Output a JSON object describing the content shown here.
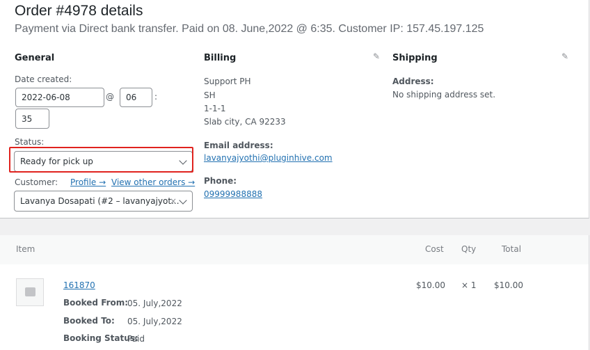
{
  "header": {
    "title": "Order #4978 details",
    "subtitle": "Payment via Direct bank transfer. Paid on 08. June,2022 @ 6:35. Customer IP: 157.45.197.125"
  },
  "general": {
    "title": "General",
    "date_created_label": "Date created:",
    "date_value": "2022-06-08",
    "at_sep": "@",
    "hour_value": "06",
    "colon_sep": ":",
    "minute_value": "35",
    "status_label": "Status:",
    "status_value": "Ready for pick up",
    "customer_label": "Customer:",
    "profile_link": "Profile →",
    "view_orders_link": "View other orders →",
    "customer_value": "Lavanya Dosapati (#2 – lavanyajyot...",
    "clear_glyph": "×"
  },
  "billing": {
    "title": "Billing",
    "address_lines": [
      "Support PH",
      "SH",
      "1-1-1",
      "Slab city, CA 92233"
    ],
    "email_label": "Email address:",
    "email_value": "lavanyajyothi@pluginhive.com",
    "phone_label": "Phone:",
    "phone_value": "09999988888"
  },
  "shipping": {
    "title": "Shipping",
    "address_label": "Address:",
    "address_value": "No shipping address set."
  },
  "icons": {
    "edit": "pencil-icon",
    "chevron": "chevron-down-icon",
    "thumb": "image-placeholder-icon"
  },
  "items": {
    "columns": {
      "item": "Item",
      "cost": "Cost",
      "qty": "Qty",
      "total": "Total"
    },
    "rows": [
      {
        "name": "161870",
        "cost": "$10.00",
        "qty": "× 1",
        "total": "$10.00",
        "meta": [
          {
            "key": "Booked From:",
            "value": "05. July,2022"
          },
          {
            "key": "Booked To:",
            "value": "05. July,2022"
          },
          {
            "key": "Booking Status:",
            "value": "Paid"
          }
        ]
      }
    ]
  }
}
